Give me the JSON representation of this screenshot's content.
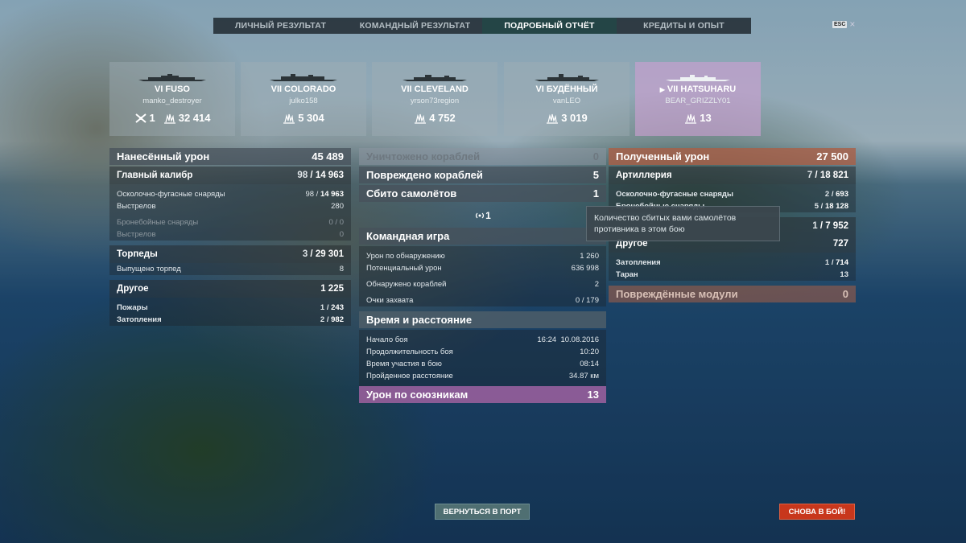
{
  "tabs": [
    {
      "label": "ЛИЧНЫЙ РЕЗУЛЬТАТ",
      "active": false
    },
    {
      "label": "КОМАНДНЫЙ РЕЗУЛЬТАТ",
      "active": false
    },
    {
      "label": "ПОДРОБНЫЙ ОТЧЁТ",
      "active": true
    },
    {
      "label": "КРЕДИТЫ И ОПЫТ",
      "active": false
    }
  ],
  "esc": {
    "key": "ESC",
    "close": "×"
  },
  "ships": [
    {
      "name": "VI FUSO",
      "player": "manko_destroyer",
      "frags": "1",
      "damage": "32 414"
    },
    {
      "name": "VII COLORADO",
      "player": "julko158",
      "damage": "5 304"
    },
    {
      "name": "VII CLEVELAND",
      "player": "yrson73region",
      "damage": "4 752"
    },
    {
      "name": "VI БУДЁННЫЙ",
      "player": "vanLEO",
      "damage": "3 019"
    },
    {
      "name": "VII HATSUHARU",
      "player": "BEAR_GRIZZLY01",
      "damage": "13",
      "self": true
    }
  ],
  "dealt": {
    "title": "Нанесённый урон",
    "total": "45 489",
    "main_caliber": {
      "label": "Главный калибр",
      "hits": "98",
      "value": "14 963"
    },
    "he": {
      "label": "Осколочно-фугасные снаряды",
      "hits": "98",
      "value": "14 963"
    },
    "he_shots": {
      "label": "Выстрелов",
      "value": "280"
    },
    "ap": {
      "label": "Бронебойные снаряды",
      "hits": "0",
      "value": "0"
    },
    "ap_shots": {
      "label": "Выстрелов",
      "value": "0"
    },
    "torpedoes": {
      "label": "Торпеды",
      "hits": "3",
      "value": "29 301"
    },
    "torp_launched": {
      "label": "Выпущено торпед",
      "value": "8"
    },
    "other": {
      "label": "Другое",
      "value": "1 225"
    },
    "fires": {
      "label": "Пожары",
      "hits": "1",
      "value": "243"
    },
    "floods": {
      "label": "Затопления",
      "hits": "2",
      "value": "982"
    }
  },
  "middle": {
    "destroyed": {
      "label": "Уничтожено кораблей",
      "value": "0"
    },
    "damaged": {
      "label": "Повреждено кораблей",
      "value": "5"
    },
    "planes": {
      "label": "Сбито самолётов",
      "value": "1"
    },
    "flags_value": "1",
    "team": {
      "title": "Командная игра",
      "spotting": {
        "label": "Урон по обнаружению",
        "value": "1 260"
      },
      "potential": {
        "label": "Потенциальный урон",
        "value": "636 998"
      },
      "spotted": {
        "label": "Обнаружено кораблей",
        "value": "2"
      },
      "capture": {
        "label": "Очки захвата",
        "a": "0",
        "b": "179"
      }
    },
    "time": {
      "title": "Время и расстояние",
      "start": {
        "label": "Начало боя",
        "time": "16:24",
        "date": "10.08.2016"
      },
      "duration": {
        "label": "Продолжительность боя",
        "value": "10:20"
      },
      "participation": {
        "label": "Время участия в бою",
        "value": "08:14"
      },
      "distance": {
        "label": "Пройденное расстояние",
        "value": "34.87 км"
      }
    },
    "ally_damage": {
      "label": "Урон по союзникам",
      "value": "13"
    }
  },
  "received": {
    "title": "Полученный урон",
    "total": "27 500",
    "artillery": {
      "label": "Артиллерия",
      "hits": "7",
      "value": "18 821"
    },
    "he": {
      "label": "Осколочно-фугасные снаряды",
      "hits": "2",
      "value": "693"
    },
    "ap": {
      "label": "Бронебойные снаряды",
      "hits": "5",
      "value": "18 128"
    },
    "torp": {
      "hits": "1",
      "value": "7 952"
    },
    "other": {
      "label": "Другое",
      "value": "727"
    },
    "floods": {
      "label": "Затопления",
      "hits": "1",
      "value": "714"
    },
    "ram": {
      "label": "Таран",
      "value": "13"
    },
    "modules": {
      "label": "Повреждённые модули",
      "value": "0"
    }
  },
  "tooltip": {
    "text": "Количество сбитых вами самолётов противника в этом бою"
  },
  "buttons": {
    "port": "ВЕРНУТЬСЯ В ПОРТ",
    "battle": "СНОВА В БОЙ!"
  }
}
